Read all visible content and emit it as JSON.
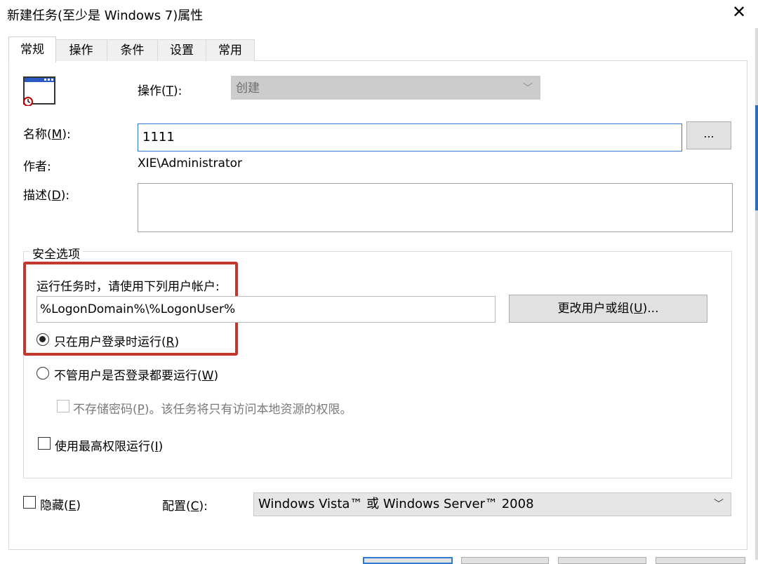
{
  "window": {
    "title": "新建任务(至少是 Windows 7)属性",
    "close_glyph": "✕"
  },
  "tabs": [
    {
      "label": "常规"
    },
    {
      "label": "操作"
    },
    {
      "label": "条件"
    },
    {
      "label": "设置"
    },
    {
      "label": "常用"
    }
  ],
  "general": {
    "operation_label": "操作(",
    "operation_key": "T",
    "operation_label_end": "):",
    "operation_value": "创建",
    "name_label": "名称(",
    "name_key": "M",
    "name_label_end": "):",
    "name_value": "1111",
    "browse_label": "...",
    "author_label": "作者:",
    "author_value": "XIE\\Administrator",
    "desc_label": "描述(",
    "desc_key": "D",
    "desc_label_end": "):"
  },
  "security": {
    "legend": "安全选项",
    "run_as_label": "运行任务时，请使用下列用户帐户:",
    "user_value": "%LogonDomain%\\%LogonUser%",
    "change_user_label": "更改用户或组(",
    "change_user_key": "U",
    "change_user_end": ")...",
    "radio_logged_on": "只在用户登录时运行(",
    "radio_logged_on_key": "R",
    "radio_logged_on_end": ")",
    "radio_always": "不管用户是否登录都要运行(",
    "radio_always_key": "W",
    "radio_always_end": ")",
    "no_store_password": "不存储密码(",
    "no_store_password_key": "P",
    "no_store_password_end": ")。该任务将只有访问本地资源的权限。",
    "highest_priv": "使用最高权限运行(",
    "highest_priv_key": "I",
    "highest_priv_end": ")"
  },
  "footer": {
    "hidden_label": "隐藏(",
    "hidden_key": "E",
    "hidden_end": ")",
    "config_label": "配置(",
    "config_key": "C",
    "config_end": "):",
    "config_value": "Windows Vista™ 或 Windows Server™ 2008"
  },
  "colors": {
    "highlight": "#c5372c",
    "focus_border": "#2f7ad6"
  },
  "icons": {
    "task": "task-window-icon",
    "dropdown": "chevron-down-icon"
  }
}
